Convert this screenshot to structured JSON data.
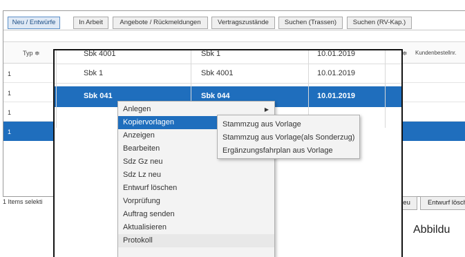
{
  "tabs": [
    {
      "label": "Neu / Entwürfe"
    },
    {
      "label": "In Arbeit"
    },
    {
      "label": "Angebote / Rückmeldungen"
    },
    {
      "label": "Vertragszustände"
    },
    {
      "label": "Suchen (Trassen)"
    },
    {
      "label": "Suchen (RV-Kap.)"
    }
  ],
  "grid": {
    "header": {
      "typ": "Typ ≑",
      "sort": "≑",
      "kundenbestellnr": "Kundenbestellnr."
    },
    "rows": [
      {
        "typ": "1"
      },
      {
        "typ": "1"
      },
      {
        "typ": "1"
      },
      {
        "typ": "1"
      }
    ]
  },
  "footer": {
    "items_selected": "1 Items selekti",
    "neu_button": "neu",
    "entwurf_loeschen_button": "Entwurf lösch"
  },
  "zoom": {
    "rows": [
      {
        "col1": "Sbk 4001",
        "col2": "Sbk 1",
        "date": "10.01.2019"
      },
      {
        "col1": "Sbk 1",
        "col2": "Sbk 4001",
        "date": "10.01.2019"
      },
      {
        "col1": "Sbk 041",
        "col2": "Sbk 044",
        "date": "10.01.2019"
      }
    ]
  },
  "context_menu": {
    "items": [
      "Anlegen",
      "Kopiervorlagen",
      "Anzeigen",
      "Bearbeiten",
      "Sdz Gz neu",
      "Sdz Lz neu",
      "Entwurf löschen",
      "Vorprüfung",
      "Auftrag senden",
      "Aktualisieren",
      "Protokoll"
    ],
    "arrow_glyph": "▶"
  },
  "submenu": {
    "items": [
      "Stammzug aus Vorlage",
      "Stammzug aus Vorlage(als Sonderzug)",
      "Ergänzungsfahrplan aus Vorlage"
    ]
  },
  "caption": "Abbildu",
  "colors": {
    "selection": "#1f6ebd",
    "active_tab": "#dfe9f5"
  }
}
